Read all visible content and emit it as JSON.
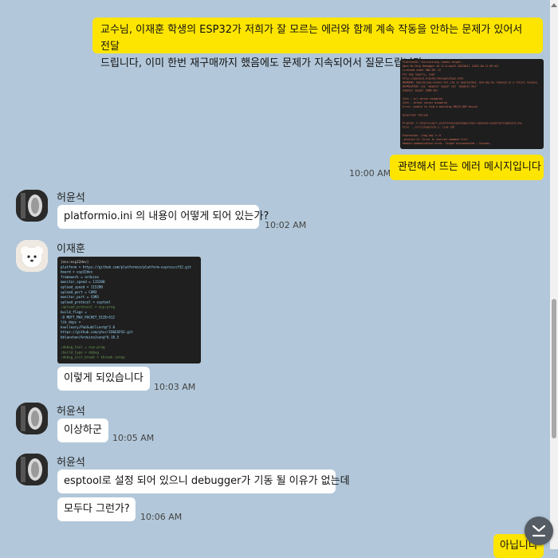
{
  "messages": {
    "m1": {
      "text_line1": "교수님, 이재훈 학생의 ESP32가 저희가 잘 모르는 에러와 함께 계속 작동을 안하는 문제가 있어서 전달",
      "text_line2": "드립니다, 이미 한번 재구매까지 했음에도 문제가 지속되어서 질문드립니다"
    },
    "m2": {
      "text": "관련해서 뜨는 에러 메시지입니다",
      "time": "10:00 AM"
    },
    "m3": {
      "sender": "허윤석",
      "text": "platformio.ini 의 내용이 어떻게 되어 있는가?",
      "time": "10:02 AM"
    },
    "m4": {
      "sender": "이재훈",
      "text": "이렇게 되있습니다",
      "time": "10:03 AM"
    },
    "m5": {
      "sender": "허윤석",
      "text": "이상하군",
      "time": "10:05 AM"
    },
    "m6": {
      "sender": "허윤석",
      "text1": "esptool로 설정 되어 있으니 debugger가 기동 될 이유가 없는데",
      "text2": "모두다 그런가?",
      "time": "10:06 AM"
    },
    "m7": {
      "text": "아닙니다"
    }
  },
  "screenshot_error": {
    "lines": [
      "PlatformIO: Initializing remote target...",
      "Open On-Chip Debugger v0.11.0-esp32-20220411 (2022-04-11-09:43)",
      "Licensed under GNU GPL v2",
      "For bug reports, read",
      "        http://openocd.org/doc/doxygen/bugs.html",
      "WARNING: boards/esp-wrover-kit.cfg is deprecated, and may be removed in a future release.",
      "DEPRECATED! use 'adapter speed' not 'adapter_khz'",
      "adapter speed: 5000 kHz",
      "",
      "Info : tcl server disabled",
      "Info : telnet server disabled",
      "Error: unable to find a matching CMSIS-DAP device",
      "",
      "Assertion failed!",
      "",
      "Program: C:\\Users\\user\\.platformio\\packages\\tool-openocd-esp32\\bin\\openocd.exe",
      "File: ../src/jtag/core.c, Line 136",
      "",
      "Expression: jtag_tap != 0",
      ".pioinit:11: Error in sourced command file:",
      "Remote communication error.  Target disconnected.: Success."
    ]
  },
  "screenshot_ini": {
    "lines": [
      "[env:esp32dev]",
      "platform = https://github.com/platformio/platform-espressif32.git",
      "board = esp32dev",
      "framework = arduino",
      "monitor_speed = 115200",
      "upload_speed = 115200",
      "upload_port = COM3",
      "monitor_port = COM3",
      "upload_protocol = esptool",
      ";upload_protocol = esp-prog",
      "build_flags =",
      "    -D MQTT_MAX_PACKET_SIZE=512",
      "lib_deps =",
      "    knolleary/PubSubClient@^2.8",
      "    https://github.com/yhur/IO6ESP32.git",
      "    bblanchon/ArduinoJson@^6.18.5",
      "",
      ";debug_tool = esp-prog",
      ";build_type = debug",
      ";debug_init_break = tbreak setup"
    ]
  },
  "colors": {
    "background": "#b2c7d9",
    "my_bubble": "#fee500",
    "their_bubble": "#ffffff"
  },
  "icons": {
    "avatar_1": "avatar-dark",
    "avatar_2": "avatar-dog",
    "scroll_down": "chevron-down-icon"
  }
}
